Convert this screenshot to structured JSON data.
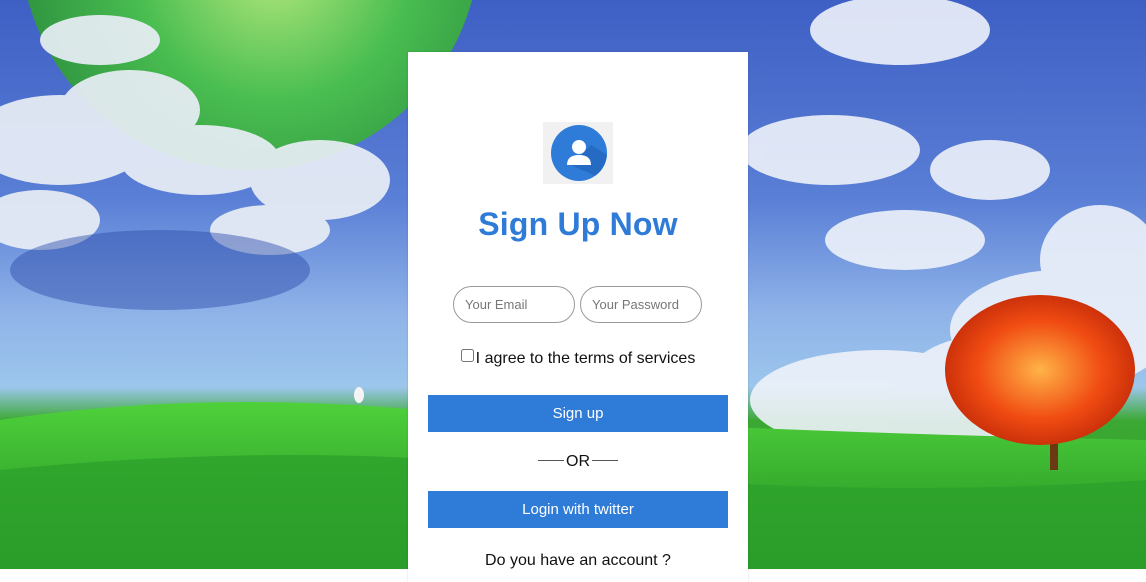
{
  "form": {
    "title": "Sign Up Now",
    "email_placeholder": "Your Email",
    "password_placeholder": "Your Password",
    "terms_label": "I agree to the terms of services",
    "signup_label": "Sign up",
    "or_label": "OR",
    "twitter_label": "Login with twitter",
    "account_prompt": "Do you have an account ?"
  },
  "colors": {
    "accent": "#2f7bd8",
    "card_background": "#ffffff"
  },
  "icons": {
    "avatar": "user-avatar-icon"
  }
}
